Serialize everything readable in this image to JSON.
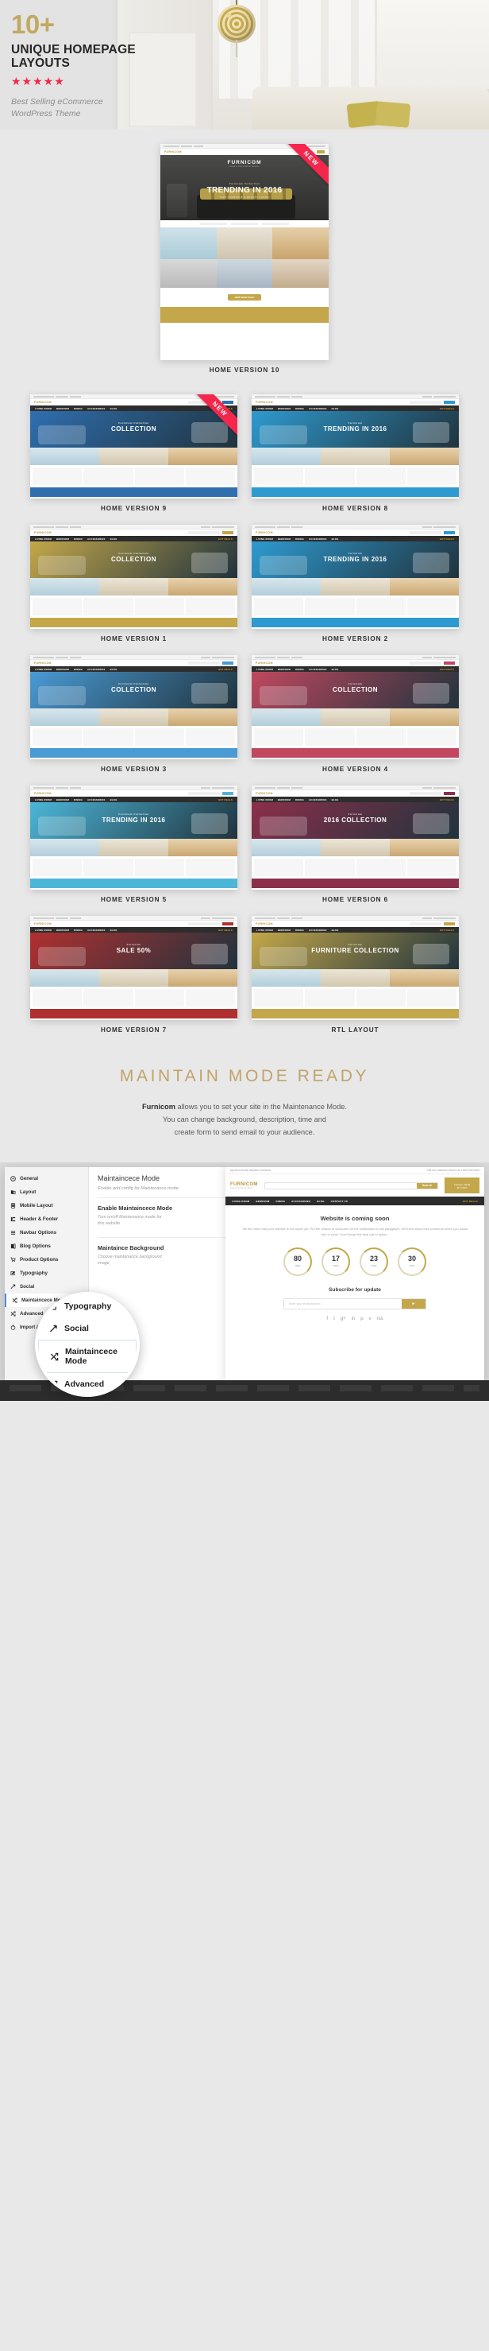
{
  "hero": {
    "count": "10+",
    "headline": "UNIQUE HOMEPAGE\nLAYOUTS",
    "headline_line1": "UNIQUE HOMEPAGE",
    "headline_line2": "LAYOUTS",
    "stars": "★★★★★",
    "tagline_line1": "Best Selling eCommerce",
    "tagline_line2": "WordPress Theme",
    "accent_color": "#c0a961",
    "star_color": "#f5264c"
  },
  "featured": {
    "caption": "HOME VERSION 10",
    "ribbon": "NEW",
    "brand": "FURNICOM",
    "brand_sub": "Home Furniture Store",
    "slide_kicker": "Furnicom Collection",
    "slide_title": "TRENDING IN 2016",
    "slide_sub": "GIFT YOURSELF A BEAUTY LIVING",
    "cta": "VIEW NOW AVAIL"
  },
  "grid": [
    {
      "caption": "HOME VERSION 9",
      "ribbon": "NEW",
      "accent": "#2f6fb0",
      "kicker": "Furnicom Collection",
      "title": "COLLECTION"
    },
    {
      "caption": "HOME VERSION 8",
      "ribbon": "",
      "accent": "#2e9ad0",
      "kicker": "Furnicom",
      "title": "TRENDING IN 2016"
    },
    {
      "caption": "HOME VERSION 1",
      "ribbon": "",
      "accent": "#c3a74a",
      "kicker": "Furnicom Collection",
      "title": "COLLECTION"
    },
    {
      "caption": "HOME VERSION 2",
      "ribbon": "",
      "accent": "#2e9ad0",
      "kicker": "Furnicom",
      "title": "TRENDING IN 2016"
    },
    {
      "caption": "HOME VERSION 3",
      "ribbon": "",
      "accent": "#4a9ad4",
      "kicker": "Furnicom Collection",
      "title": "COLLECTION"
    },
    {
      "caption": "HOME VERSION 4",
      "ribbon": "",
      "accent": "#c0485f",
      "kicker": "Furnicom",
      "title": "COLLECTION"
    },
    {
      "caption": "HOME VERSION 5",
      "ribbon": "",
      "accent": "#4cb6d8",
      "kicker": "Furnicom Collection",
      "title": "TRENDING IN 2016"
    },
    {
      "caption": "HOME VERSION 6",
      "ribbon": "",
      "accent": "#8c2f4a",
      "kicker": "Furnicom",
      "title": "2016 COLLECTION"
    },
    {
      "caption": "HOME VERSION 7",
      "ribbon": "",
      "accent": "#b03030",
      "kicker": "Furnicom",
      "title": "SALE 50%"
    },
    {
      "caption": "RTL LAYOUT",
      "ribbon": "",
      "accent": "#c3a74a",
      "kicker": "Furnicom",
      "title": "FURNITURE COLLECTION"
    }
  ],
  "maintain": {
    "title_main": "MAINTAIN MODE",
    "title_accent": "READY",
    "brand": "Furnicom",
    "body_rest": " allows you to set your site in the Maintenance Mode.",
    "body_line2": "You can change background, description, time and",
    "body_line3": "create form to send email to your audience.",
    "accent_color": "#c2a26a"
  },
  "admin": {
    "sidebar": [
      {
        "label": "General",
        "icon": "circle-target-icon"
      },
      {
        "label": "Layout",
        "icon": "layers-icon"
      },
      {
        "label": "Mobile Layout",
        "icon": "mobile-icon"
      },
      {
        "label": "Header & Footer",
        "icon": "header-footer-icon"
      },
      {
        "label": "Navbar Options",
        "icon": "menu-bars-icon"
      },
      {
        "label": "Blog Options",
        "icon": "blog-icon"
      },
      {
        "label": "Product Options",
        "icon": "cart-icon"
      },
      {
        "label": "Typography",
        "icon": "pencil-icon"
      },
      {
        "label": "Social",
        "icon": "share-icon"
      },
      {
        "label": "Maintaincece Mode",
        "icon": "shuffle-icon"
      },
      {
        "label": "Advanced",
        "icon": "shuffle-icon"
      },
      {
        "label": "Import / Export",
        "icon": "power-icon"
      }
    ],
    "active_item": "Maintaincece Mode",
    "panel_title": "Maintaincece Mode",
    "panel_desc": "Enable and config for Maintenance mode",
    "fields": [
      {
        "label": "Enable Maintaincece Mode",
        "help_line1": "Turn on/off Maintenance mode for",
        "help_line2": "this website"
      },
      {
        "label": "Maintaince Background",
        "help_line1": "Choose maintanance background",
        "help_line2": "image"
      }
    ],
    "magnifier_items": [
      {
        "label": "Typography",
        "icon": "pencil-icon",
        "active": false
      },
      {
        "label": "Social",
        "icon": "share-icon",
        "active": false
      },
      {
        "label": "Maintaincece Mode",
        "icon": "shuffle-icon",
        "active": true
      },
      {
        "label": "Advanced",
        "icon": "shuffle-icon",
        "active": false
      },
      {
        "label": "Import / Export",
        "icon": "power-icon",
        "active": false
      }
    ],
    "preview": {
      "topbar_left": "My Account  My Wishlist  Checkout",
      "topbar_right": "Call our customer service at 1 800 000 0000",
      "logo": "FURNICOM",
      "logo_sub": "Home Furniture Store",
      "search_placeholder": "Enter your keyword",
      "search_button": "Search",
      "shipping": "Shipping For Shipping",
      "cart": "0 item(s) - $0.00",
      "cart_label": "MY CART",
      "nav": [
        "LIVING ROOM",
        "BEDROOM",
        "DINING",
        "ACCESSORIES",
        "BLOG",
        "CONTACT US"
      ],
      "nav_deals": "HOT DEALS",
      "heading": "Website is coming soon",
      "paragraph": "Tell the users that your website is not active yet. Put the reason to subscribe for the notification in this paragraph. Tell them about their problems which you would like to solve. Don't forget the final call to action.",
      "counters": [
        {
          "value": "80",
          "unit": "days"
        },
        {
          "value": "17",
          "unit": "hours"
        },
        {
          "value": "23",
          "unit": "mins"
        },
        {
          "value": "30",
          "unit": "secs"
        }
      ],
      "subscribe_heading": "Subscribe for update",
      "subscribe_placeholder": "Enter your email address",
      "subscribe_button": "send-icon",
      "socials": [
        "f",
        "t",
        "g+",
        "in",
        "p",
        "v",
        "rss"
      ],
      "accent_color": "#c3a74a"
    }
  }
}
